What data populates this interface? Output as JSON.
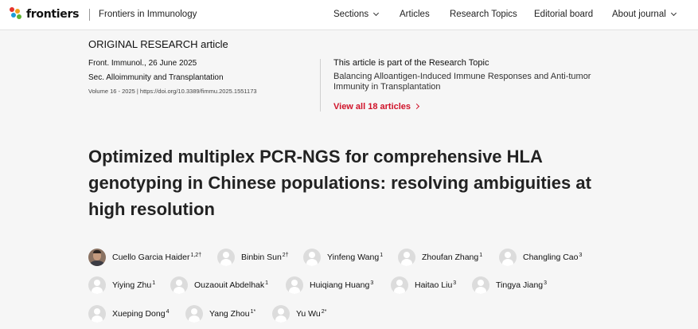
{
  "header": {
    "logo_text": "frontiers",
    "journal": "Frontiers in Immunology",
    "nav": [
      {
        "label": "Sections",
        "dropdown": true
      },
      {
        "label": "Articles",
        "dropdown": false
      },
      {
        "label": "Research Topics",
        "dropdown": false
      },
      {
        "label": "Editorial board",
        "dropdown": false
      },
      {
        "label": "About journal",
        "dropdown": true
      }
    ]
  },
  "article": {
    "type": "ORIGINAL RESEARCH article",
    "journal_date": "Front. Immunol., 26 June 2025",
    "section": "Sec. Alloimmunity and Transplantation",
    "volume_doi": "Volume 16 - 2025 | https://doi.org/10.3389/fimmu.2025.1551173",
    "title": "Optimized multiplex PCR-NGS for comprehensive HLA genotyping in Chinese populations: resolving ambiguities at high resolution"
  },
  "research_topic": {
    "heading": "This article is part of the Research Topic",
    "title": "Balancing Alloantigen-Induced Immune Responses and Anti-tumor Immunity in Transplantation",
    "link": "View all 18 articles"
  },
  "authors": [
    {
      "name": "Cuello Garcia Haider",
      "sup": "1,2†",
      "photo": true
    },
    {
      "name": "Binbin Sun",
      "sup": "2†",
      "photo": false
    },
    {
      "name": "Yinfeng Wang",
      "sup": "1",
      "photo": false
    },
    {
      "name": "Zhoufan Zhang",
      "sup": "1",
      "photo": false
    },
    {
      "name": "Changling Cao",
      "sup": "3",
      "photo": false
    },
    {
      "name": "Yiying Zhu",
      "sup": "1",
      "photo": false
    },
    {
      "name": "Ouzaouit Abdelhak",
      "sup": "1",
      "photo": false
    },
    {
      "name": "Huiqiang Huang",
      "sup": "3",
      "photo": false
    },
    {
      "name": "Haitao Liu",
      "sup": "3",
      "photo": false
    },
    {
      "name": "Tingya Jiang",
      "sup": "3",
      "photo": false
    },
    {
      "name": "Xueping Dong",
      "sup": "4",
      "photo": false
    },
    {
      "name": "Yang Zhou",
      "sup": "1*",
      "photo": false
    },
    {
      "name": "Yu Wu",
      "sup": "2*",
      "photo": false
    }
  ],
  "colors": {
    "accent": "#d0132a",
    "logo": [
      "#e6342c",
      "#f2a01c",
      "#1d9cd8",
      "#5fb334"
    ]
  }
}
